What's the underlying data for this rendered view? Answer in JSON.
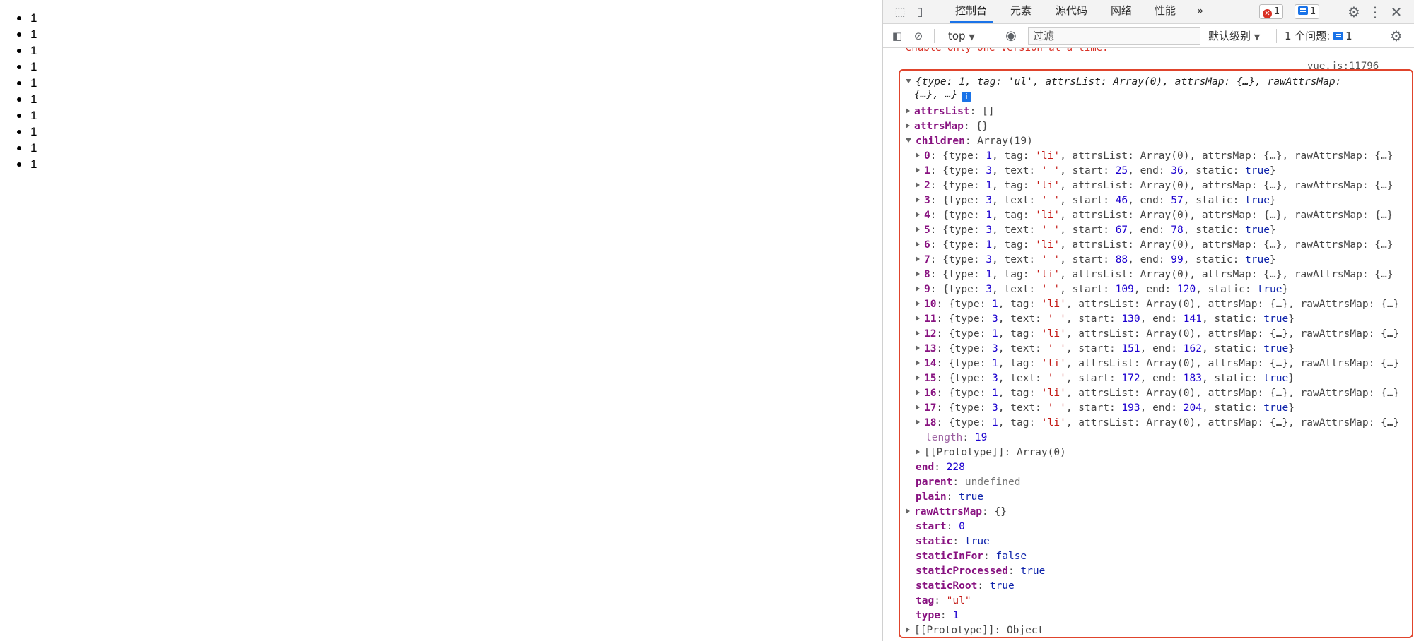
{
  "page": {
    "list_items": [
      "1",
      "1",
      "1",
      "1",
      "1",
      "1",
      "1",
      "1",
      "1",
      "1"
    ]
  },
  "devtools": {
    "tabs": [
      "控制台",
      "元素",
      "源代码",
      "网络",
      "性能"
    ],
    "more_tabs": "»",
    "error_count": "1",
    "message_count": "1",
    "toolbar": {
      "context": "top",
      "filter_placeholder": "过滤",
      "levels": "默认级别",
      "issues_label": "1 个问题:",
      "issues_count": "1"
    },
    "console": {
      "warning_text": "enable only one version at a time.",
      "source_link": "vue.js:11796",
      "summary_line1": "{type: 1, tag: 'ul', attrsList: Array(0), attrsMap: {…}, rawAttrsMap:",
      "summary_line2": "{…}, …}",
      "attrsList": {
        "key": "attrsList",
        "value": "[]"
      },
      "attrsMap": {
        "key": "attrsMap",
        "value": "{}"
      },
      "children": {
        "key": "children",
        "value": "Array(19)"
      },
      "child_items": [
        {
          "idx": "0",
          "type": "1",
          "tag": "'li'"
        },
        {
          "idx": "1",
          "type": "3",
          "text": "' '",
          "start": "25",
          "end": "36",
          "static": "true"
        },
        {
          "idx": "2",
          "type": "1",
          "tag": "'li'"
        },
        {
          "idx": "3",
          "type": "3",
          "text": "' '",
          "start": "46",
          "end": "57",
          "static": "true"
        },
        {
          "idx": "4",
          "type": "1",
          "tag": "'li'"
        },
        {
          "idx": "5",
          "type": "3",
          "text": "' '",
          "start": "67",
          "end": "78",
          "static": "true"
        },
        {
          "idx": "6",
          "type": "1",
          "tag": "'li'"
        },
        {
          "idx": "7",
          "type": "3",
          "text": "' '",
          "start": "88",
          "end": "99",
          "static": "true"
        },
        {
          "idx": "8",
          "type": "1",
          "tag": "'li'"
        },
        {
          "idx": "9",
          "type": "3",
          "text": "' '",
          "start": "109",
          "end": "120",
          "static": "true"
        },
        {
          "idx": "10",
          "type": "1",
          "tag": "'li'"
        },
        {
          "idx": "11",
          "type": "3",
          "text": "' '",
          "start": "130",
          "end": "141",
          "static": "true"
        },
        {
          "idx": "12",
          "type": "1",
          "tag": "'li'"
        },
        {
          "idx": "13",
          "type": "3",
          "text": "' '",
          "start": "151",
          "end": "162",
          "static": "true"
        },
        {
          "idx": "14",
          "type": "1",
          "tag": "'li'"
        },
        {
          "idx": "15",
          "type": "3",
          "text": "' '",
          "start": "172",
          "end": "183",
          "static": "true"
        },
        {
          "idx": "16",
          "type": "1",
          "tag": "'li'"
        },
        {
          "idx": "17",
          "type": "3",
          "text": "' '",
          "start": "193",
          "end": "204",
          "static": "true"
        },
        {
          "idx": "18",
          "type": "1",
          "tag": "'li'"
        }
      ],
      "element_tail": "attrsList: Array(0), attrsMap: {…}, rawAttrsMap: {…}",
      "length": {
        "key": "length",
        "value": "19"
      },
      "array_proto": {
        "key": "[[Prototype]]",
        "value": "Array(0)"
      },
      "props": [
        {
          "key": "end",
          "value": "228",
          "kind": "n"
        },
        {
          "key": "parent",
          "value": "undefined",
          "kind": "u"
        },
        {
          "key": "plain",
          "value": "true",
          "kind": "b"
        },
        {
          "key": "rawAttrsMap",
          "value": "{}",
          "kind": "plain",
          "expand": true
        },
        {
          "key": "start",
          "value": "0",
          "kind": "n"
        },
        {
          "key": "static",
          "value": "true",
          "kind": "b"
        },
        {
          "key": "staticInFor",
          "value": "false",
          "kind": "b"
        },
        {
          "key": "staticProcessed",
          "value": "true",
          "kind": "b"
        },
        {
          "key": "staticRoot",
          "value": "true",
          "kind": "b"
        },
        {
          "key": "tag",
          "value": "\"ul\"",
          "kind": "s"
        },
        {
          "key": "type",
          "value": "1",
          "kind": "n"
        }
      ],
      "object_proto": {
        "key": "[[Prototype]]",
        "value": "Object"
      }
    }
  }
}
